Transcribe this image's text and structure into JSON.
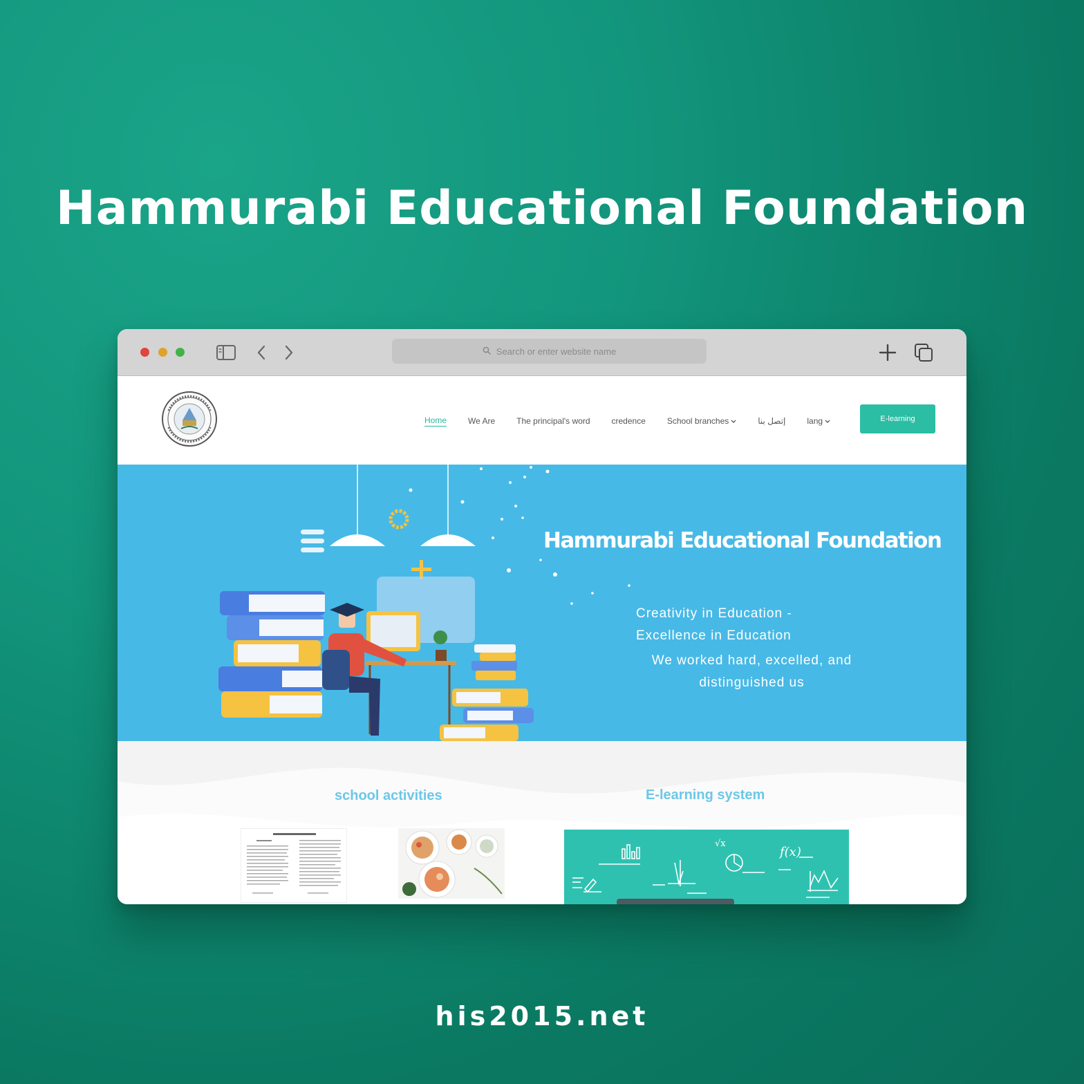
{
  "page": {
    "heading": "Hammurabi Educational Foundation",
    "domain": "his2015.net",
    "background_color": "#12957c"
  },
  "browser": {
    "address_placeholder": "Search or enter website name",
    "icons": [
      "sidebar-icon",
      "back-icon",
      "forward-icon",
      "search-icon",
      "new-tab-icon",
      "tabs-icon"
    ]
  },
  "site": {
    "nav": {
      "items": [
        {
          "label": "Home",
          "active": true
        },
        {
          "label": "We Are"
        },
        {
          "label": "The principal's word"
        },
        {
          "label": "credence"
        },
        {
          "label": "School branches",
          "dropdown": true
        },
        {
          "label": "إتصل بنا"
        },
        {
          "label": "lang",
          "dropdown": true
        }
      ],
      "cta": "E-learning"
    },
    "hero": {
      "title": "Hammurabi Educational Foundation",
      "tagline_1": "Creativity in Education -",
      "tagline_2": "Excellence in Education",
      "sub": "We worked hard, excelled, and distinguished us",
      "background_color": "#47b9e6"
    },
    "sections": {
      "activities_title": "school activities",
      "elearning_title": "E-learning system"
    },
    "accent_color": "#2bbea4"
  }
}
